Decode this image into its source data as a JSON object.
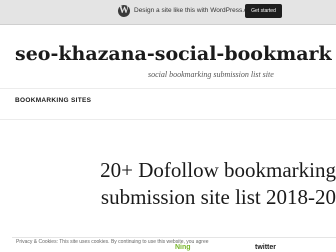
{
  "topbar": {
    "logo": "W",
    "promo_text": "Design a site like this with WordPress.com",
    "cta_label": "Get started"
  },
  "header": {
    "site_title": "seo-khazana-social-bookmark",
    "tagline": "social bookmarking submission list site"
  },
  "nav": {
    "items": [
      {
        "label": "BOOKMARKING SITES"
      }
    ]
  },
  "post": {
    "title_line1": "20+ Dofollow bookmarking",
    "title_line2": "submission site list 2018-20"
  },
  "cookie_notice": {
    "text": "Privacy & Cookies: This site uses cookies. By continuing to use this website, you agree"
  },
  "thumbnails": {
    "ning": "Ning",
    "twitter": "twitter"
  },
  "colors": {
    "topbar_bg": "#e4e4e4",
    "cta_bg": "#1e1e1e",
    "ning": "#76b52a"
  }
}
